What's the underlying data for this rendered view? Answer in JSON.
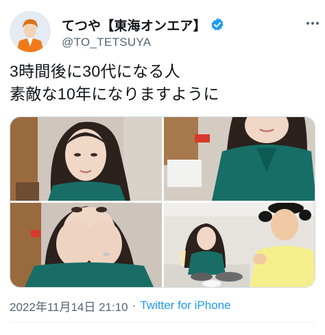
{
  "author": {
    "display_name": "てつや【東海オンエア】",
    "handle": "@TO_TETSUYA",
    "verified": true
  },
  "tweet": {
    "text_lines": [
      "3時間後に30代になる人",
      "素敵な10年になりますように"
    ]
  },
  "media": {
    "photo_count": 4
  },
  "footer": {
    "timestamp": "2022年11月14日 21:10",
    "separator": "·",
    "source": "Twitter for iPhone"
  },
  "colors": {
    "link": "#1d9bf0",
    "secondary_text": "#536471",
    "primary_text": "#0f1419",
    "verified_badge": "#1d9bf0"
  },
  "icons": {
    "verified": "verified-badge-icon",
    "more": "more-options-icon"
  }
}
